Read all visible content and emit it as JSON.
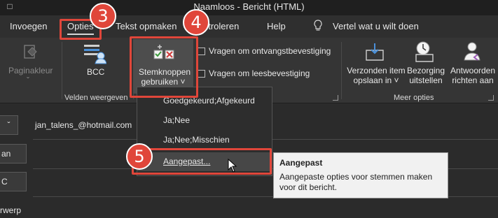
{
  "window": {
    "title": "Naamloos  -  Bericht (HTML)"
  },
  "tabs": [
    {
      "label": "Invoegen"
    },
    {
      "label": "Opties"
    },
    {
      "label": "Tekst opmaken"
    },
    {
      "label": "ntroleren"
    },
    {
      "label": "Help"
    }
  ],
  "tell_me": {
    "placeholder": "Vertel wat u wilt doen"
  },
  "ribbon": {
    "paginakleur": "Paginakleur",
    "bcc": "BCC",
    "velden_weergeven": "Velden weergeven",
    "stemknoppen_line1": "Stemknoppen",
    "stemknoppen_line2": "gebruiken ˅",
    "ontvangst": "Vragen om ontvangstbevestiging",
    "leesbevestiging": "Vragen om leesbevestiging",
    "verzonden_line1": "Verzonden item",
    "verzonden_line2": "opslaan in ˅",
    "bezorging_line1": "Bezorging",
    "bezorging_line2": "uitstellen",
    "antwoorden_line1": "Antwoorden",
    "antwoorden_line2": "richten aan",
    "meer_opties": "Meer opties"
  },
  "compose": {
    "to_value": "jan_talens_@hotmail.com",
    "btn_an": "an",
    "btn_c": "C",
    "onderwerp": "rwerp"
  },
  "dropdown": {
    "items": [
      {
        "label": "Goedgekeurd;Afgekeurd"
      },
      {
        "label": "Ja;Nee"
      },
      {
        "label": "Ja;Nee;Misschien"
      },
      {
        "label": "Aangepast..."
      }
    ]
  },
  "tooltip": {
    "title": "Aangepast",
    "body": "Aangepaste opties voor stemmen maken voor dit bericht."
  },
  "annotations": {
    "step3": "3",
    "step4": "4",
    "step5": "5"
  },
  "colors": {
    "highlight": "#e0463a",
    "ribbon": "#353535",
    "background": "#2b2b2b"
  }
}
